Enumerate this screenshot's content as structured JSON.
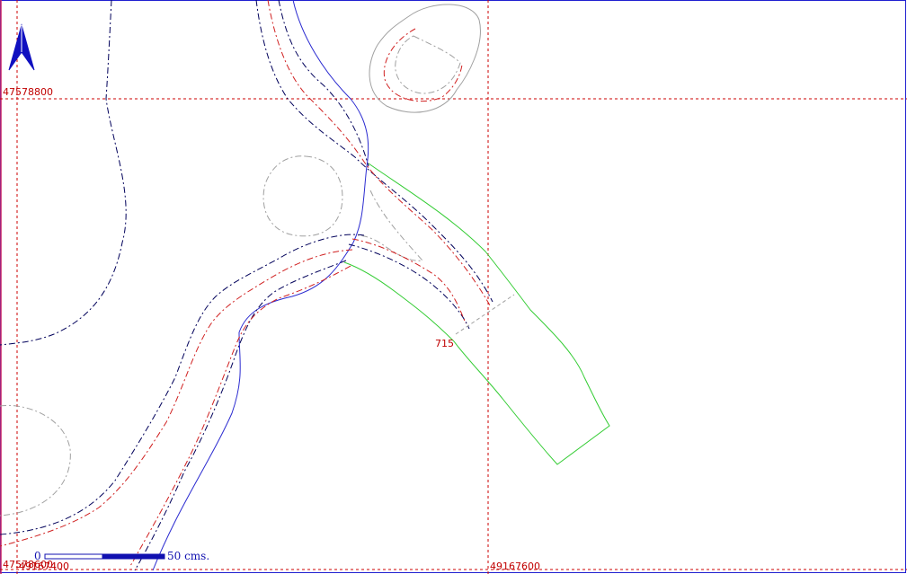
{
  "map": {
    "grid_labels": {
      "y_top": "47578800",
      "y_bottom": "47578600",
      "x_left": "49167400",
      "x_right": "49167600"
    },
    "parcel_label": "715",
    "scale": {
      "start": "0",
      "end": "50 cms."
    },
    "north_arrow_icon": "north-arrow-icon",
    "colors": {
      "grid": "#cc0000",
      "frame": "#2020d0",
      "water": "#2a2ad0",
      "contour_dark": "#00005a",
      "contour_red": "#d02020",
      "contour_gray": "#a0a0a0",
      "parcel": "#33cc33"
    }
  }
}
